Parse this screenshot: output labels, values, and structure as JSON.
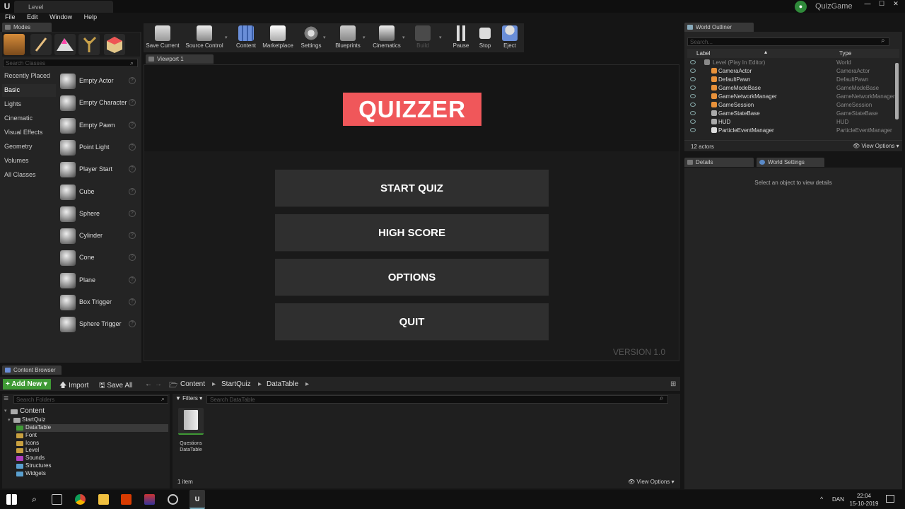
{
  "window": {
    "tab_title": "Level",
    "project_name": "QuizGame",
    "controls": [
      "—",
      "☐",
      "✕"
    ]
  },
  "menu": [
    "File",
    "Edit",
    "Window",
    "Help"
  ],
  "modes": {
    "tab_label": "Modes",
    "search_placeholder": "Search Classes",
    "categories": [
      "Recently Placed",
      "Basic",
      "Lights",
      "Cinematic",
      "Visual Effects",
      "Geometry",
      "Volumes",
      "All Classes"
    ],
    "selected_category": "Basic",
    "items": [
      "Empty Actor",
      "Empty Character",
      "Empty Pawn",
      "Point Light",
      "Player Start",
      "Cube",
      "Sphere",
      "Cylinder",
      "Cone",
      "Plane",
      "Box Trigger",
      "Sphere Trigger"
    ]
  },
  "toolbar": {
    "save_current": "Save Current",
    "source_control": "Source Control",
    "content": "Content",
    "marketplace": "Marketplace",
    "settings": "Settings",
    "blueprints": "Blueprints",
    "cinematics": "Cinematics",
    "build": "Build",
    "pause": "Pause",
    "stop": "Stop",
    "eject": "Eject"
  },
  "viewport": {
    "tab_label": "Viewport 1",
    "logo": "QUIZZER",
    "buttons": [
      "START QUIZ",
      "HIGH SCORE",
      "OPTIONS",
      "QUIT"
    ],
    "version": "VERSION 1.0"
  },
  "outliner": {
    "tab_label": "World Outliner",
    "search_placeholder": "Search...",
    "col_label": "Label",
    "col_type": "Type",
    "rows": [
      {
        "label": "Level (Play In Editor)",
        "type": "World"
      },
      {
        "label": "CameraActor",
        "type": "CameraActor"
      },
      {
        "label": "DefaultPawn",
        "type": "DefaultPawn"
      },
      {
        "label": "GameModeBase",
        "type": "GameModeBase"
      },
      {
        "label": "GameNetworkManager",
        "type": "GameNetworkManager"
      },
      {
        "label": "GameSession",
        "type": "GameSession"
      },
      {
        "label": "GameStateBase",
        "type": "GameStateBase"
      },
      {
        "label": "HUD",
        "type": "HUD"
      },
      {
        "label": "ParticleEventManager",
        "type": "ParticleEventManager"
      }
    ],
    "actor_count": "12 actors",
    "view_options": "View Options"
  },
  "details": {
    "tab_details": "Details",
    "tab_world_settings": "World Settings",
    "empty_text": "Select an object to view details"
  },
  "content_browser": {
    "tab_label": "Content Browser",
    "add_new": "Add New",
    "import": "Import",
    "save_all": "Save All",
    "path": [
      "Content",
      "StartQuiz",
      "DataTable"
    ],
    "search_folders": "Search Folders",
    "filters": "Filters",
    "search_assets": "Search DataTable",
    "folders": {
      "root": "Content",
      "parent": "StartQuiz",
      "children": [
        "DataTable",
        "Font",
        "Icons",
        "Level",
        "Sounds",
        "Structures",
        "Widgets"
      ]
    },
    "asset": {
      "name": "Questions",
      "type": "DataTable"
    },
    "item_count": "1 item",
    "view_options": "View Options"
  },
  "taskbar": {
    "language": "DAN",
    "time": "22:04",
    "date": "15-10-2019"
  },
  "colors": {
    "accent_red": "#f0575a",
    "add_new_green": "#3f9a35",
    "panel": "#242424",
    "background": "#151515"
  }
}
